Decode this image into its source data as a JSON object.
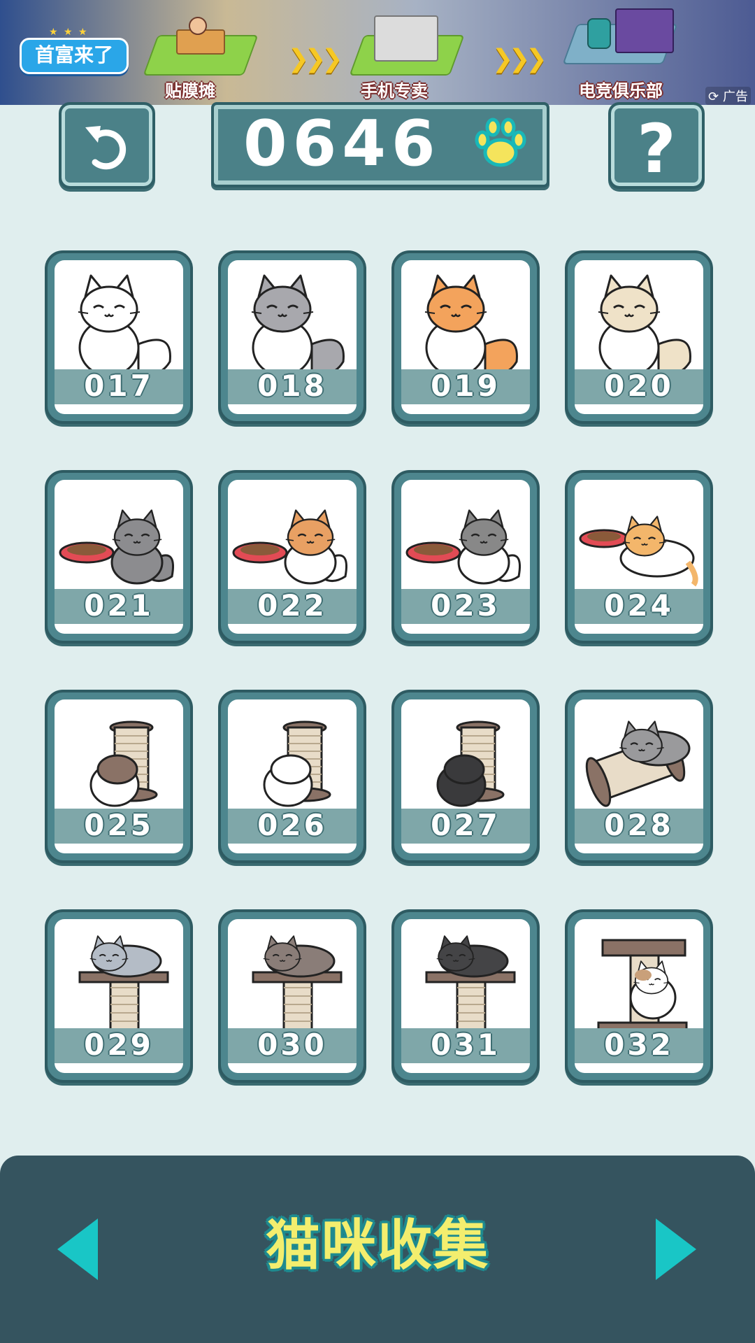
{
  "ad": {
    "logo_text": "首富来了",
    "stages": [
      "贴膜摊",
      "手机专卖",
      "电竞俱乐部"
    ],
    "tag": "广告"
  },
  "score": "0646",
  "cards": [
    {
      "id": "017",
      "art": "sitting-cat",
      "colors": {
        "body": "#ffffff",
        "accent": "#ffffff"
      }
    },
    {
      "id": "018",
      "art": "sitting-cat",
      "colors": {
        "body": "#a8a8ad",
        "accent": "#ffffff"
      }
    },
    {
      "id": "019",
      "art": "sitting-cat",
      "colors": {
        "body": "#f3a35c",
        "accent": "#ffffff"
      }
    },
    {
      "id": "020",
      "art": "sitting-cat",
      "colors": {
        "body": "#efe2c8",
        "accent": "#ffffff"
      }
    },
    {
      "id": "021",
      "art": "bowl-cat",
      "colors": {
        "body": "#8c8c8f",
        "accent": "#8c8c8f"
      }
    },
    {
      "id": "022",
      "art": "bowl-cat",
      "colors": {
        "body": "#ffffff",
        "accent": "#e8a063"
      }
    },
    {
      "id": "023",
      "art": "bowl-cat",
      "colors": {
        "body": "#ffffff",
        "accent": "#888888"
      }
    },
    {
      "id": "024",
      "art": "bowl-lying-cat",
      "colors": {
        "body": "#f3b66b",
        "accent": "#ffffff"
      }
    },
    {
      "id": "025",
      "art": "scratch-post-cat",
      "colors": {
        "body": "#ffffff",
        "accent": "#8a7266"
      }
    },
    {
      "id": "026",
      "art": "scratch-post-cat",
      "colors": {
        "body": "#ffffff",
        "accent": "#ffffff"
      }
    },
    {
      "id": "027",
      "art": "scratch-post-cat",
      "colors": {
        "body": "#3a3a3c",
        "accent": "#3a3a3c"
      }
    },
    {
      "id": "028",
      "art": "roller-cat",
      "colors": {
        "body": "#9a9a9c",
        "accent": "#ffffff"
      }
    },
    {
      "id": "029",
      "art": "tower-sleep-cat",
      "colors": {
        "body": "#b4bcc6",
        "accent": "#ffffff"
      }
    },
    {
      "id": "030",
      "art": "tower-sleep-cat",
      "colors": {
        "body": "#8a7d78",
        "accent": "#ffffff"
      }
    },
    {
      "id": "031",
      "art": "tower-sleep-cat",
      "colors": {
        "body": "#444446",
        "accent": "#ffffff"
      }
    },
    {
      "id": "032",
      "art": "tower-climb-cat",
      "colors": {
        "body": "#ffffff",
        "accent": "#c9a07a"
      }
    }
  ],
  "bottom": {
    "title": "猫咪收集",
    "prev_icon": "triangle-left-icon",
    "next_icon": "triangle-right-icon"
  },
  "colors": {
    "background": "#e0eeee",
    "panel": "#4b8188",
    "bottom_bar": "#35545f",
    "title_yellow": "#f3ee6e",
    "arrow_cyan": "#19c6c6",
    "paw_yellow": "#f5e45c"
  }
}
